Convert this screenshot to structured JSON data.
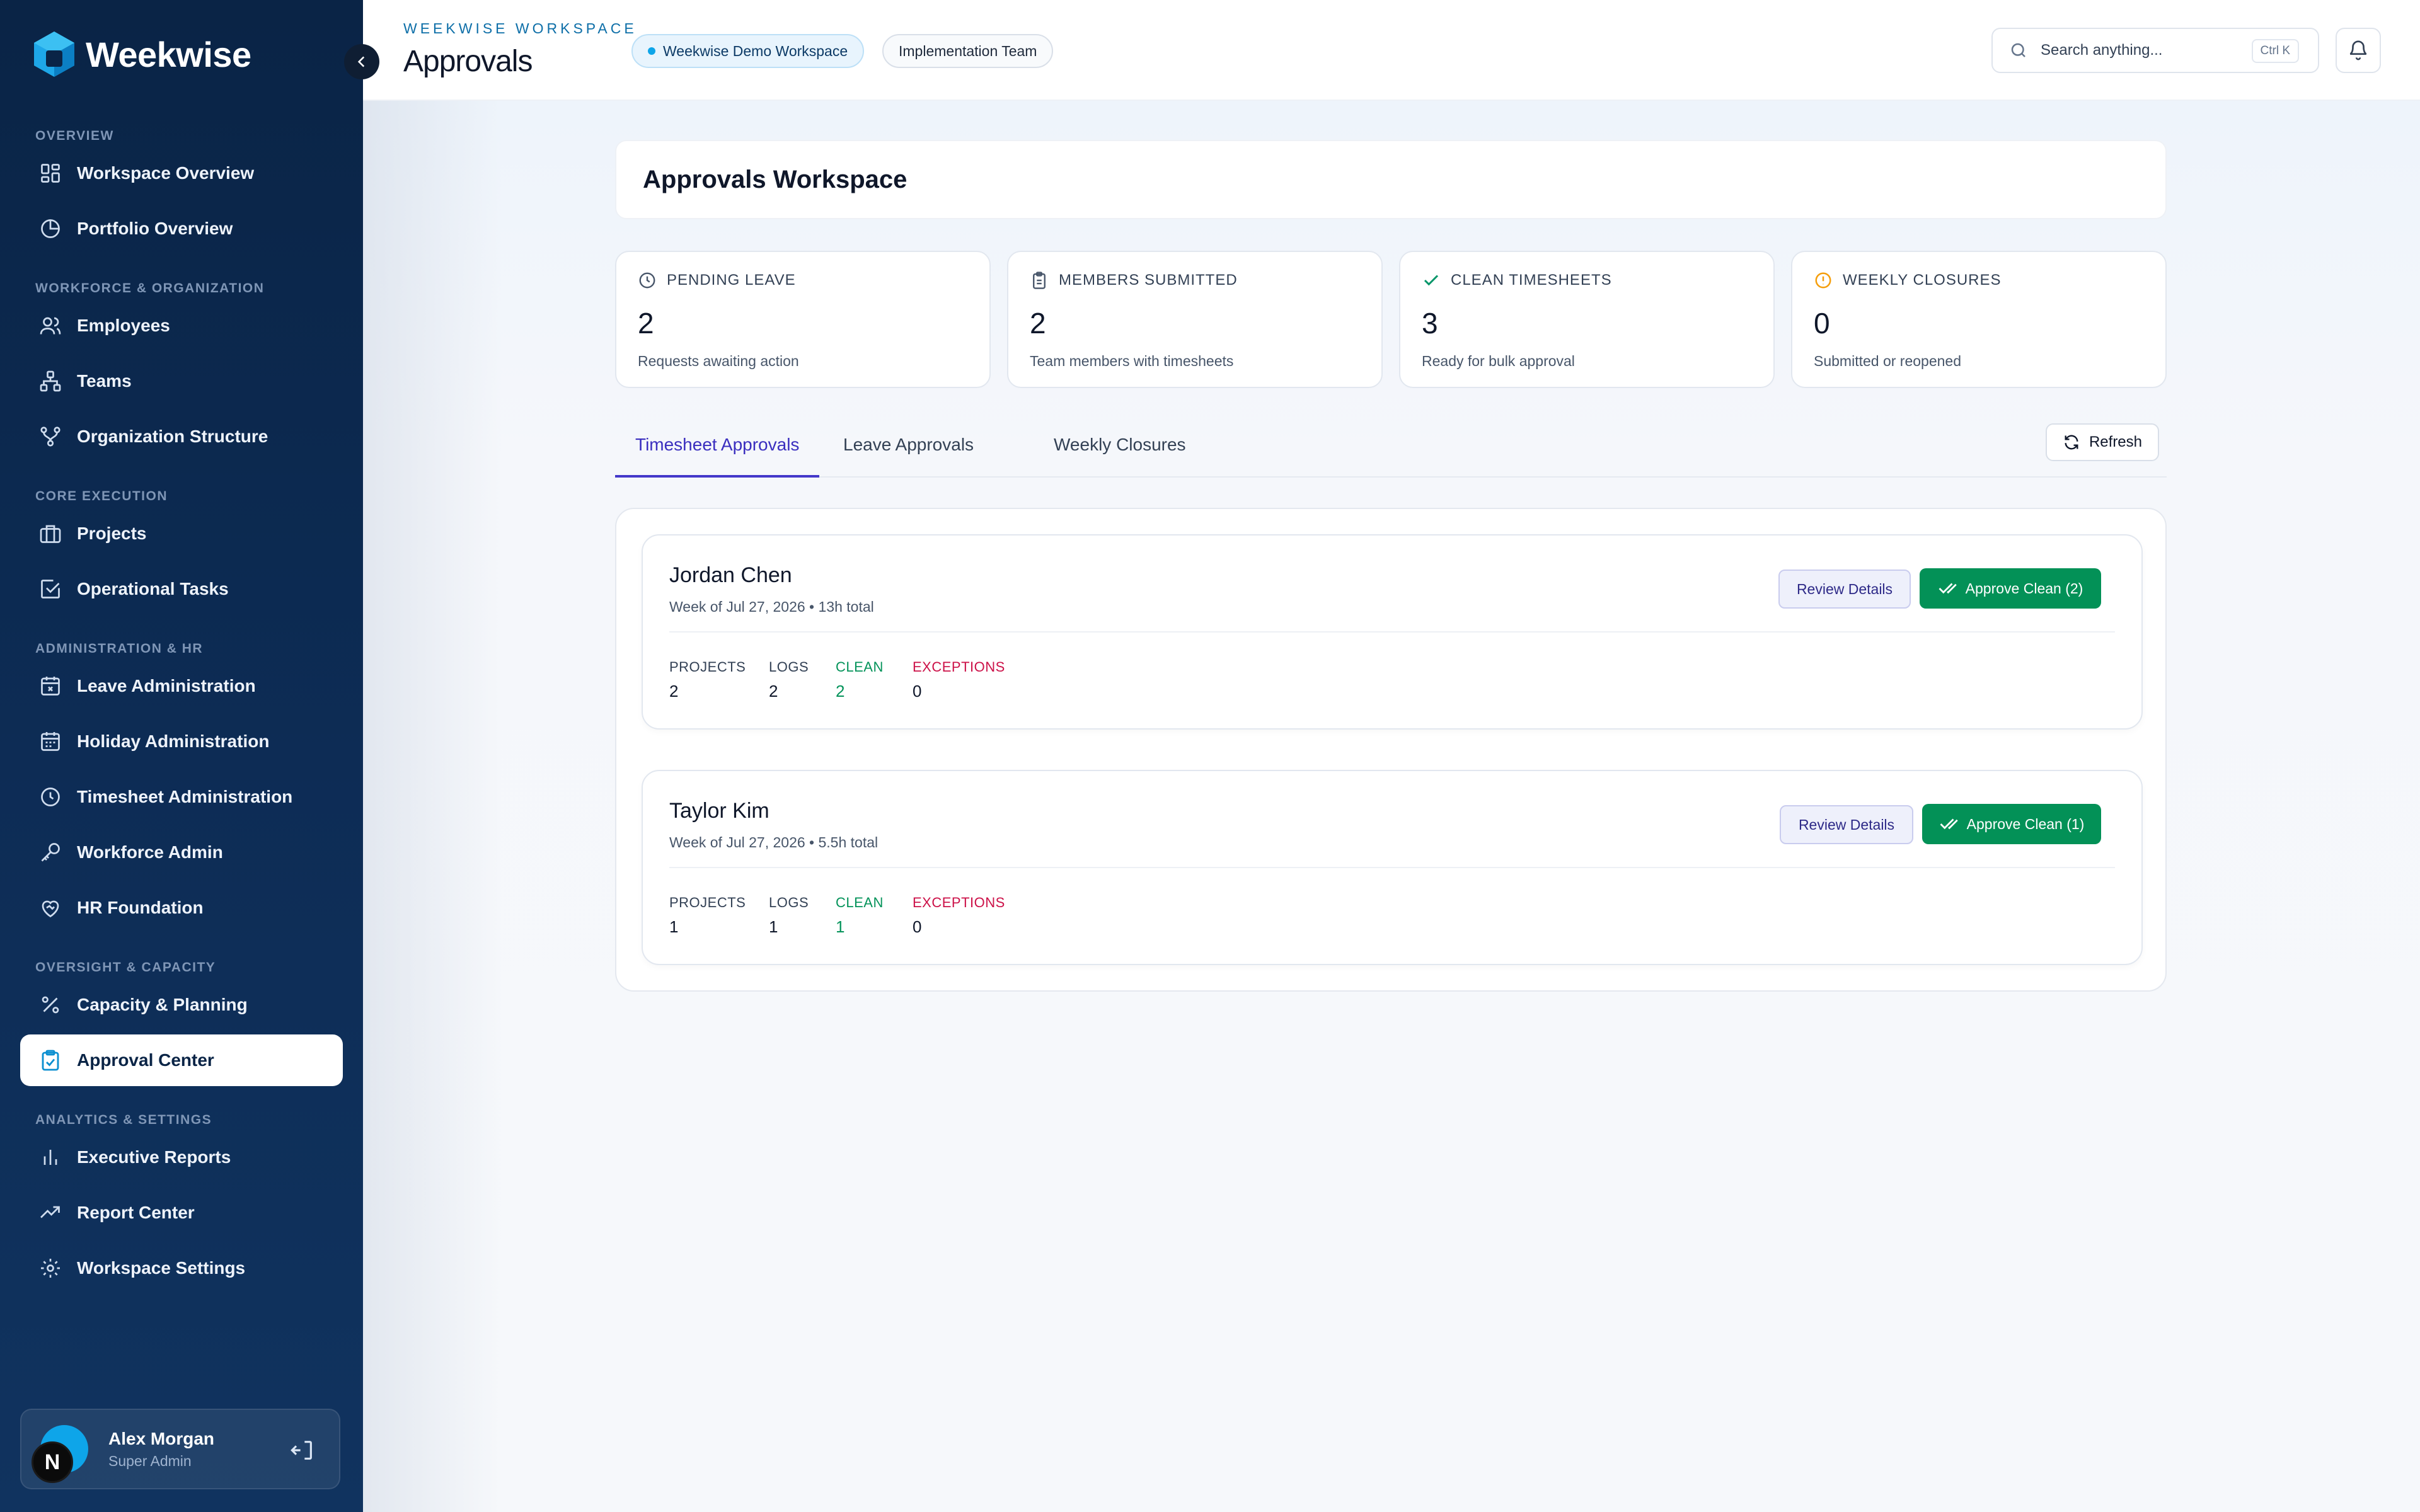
{
  "brand": {
    "name": "Weekwise"
  },
  "sidebar": {
    "sections": [
      {
        "label": "OVERVIEW",
        "items": [
          {
            "label": "Workspace Overview",
            "icon": "dashboard-icon"
          },
          {
            "label": "Portfolio Overview",
            "icon": "pie-chart-icon"
          }
        ]
      },
      {
        "label": "WORKFORCE & ORGANIZATION",
        "items": [
          {
            "label": "Employees",
            "icon": "users-icon"
          },
          {
            "label": "Teams",
            "icon": "network-icon"
          },
          {
            "label": "Organization Structure",
            "icon": "org-structure-icon"
          }
        ]
      },
      {
        "label": "CORE EXECUTION",
        "items": [
          {
            "label": "Projects",
            "icon": "briefcase-icon"
          },
          {
            "label": "Operational Tasks",
            "icon": "task-check-icon"
          }
        ]
      },
      {
        "label": "ADMINISTRATION & HR",
        "items": [
          {
            "label": "Leave Administration",
            "icon": "calendar-x-icon"
          },
          {
            "label": "Holiday Administration",
            "icon": "calendar-icon"
          },
          {
            "label": "Timesheet Administration",
            "icon": "clock-icon"
          },
          {
            "label": "Workforce Admin",
            "icon": "key-icon"
          },
          {
            "label": "HR Foundation",
            "icon": "heart-handshake-icon"
          }
        ]
      },
      {
        "label": "OVERSIGHT & CAPACITY",
        "items": [
          {
            "label": "Capacity & Planning",
            "icon": "percent-icon"
          },
          {
            "label": "Approval Center",
            "icon": "clipboard-check-icon",
            "active": true
          }
        ]
      },
      {
        "label": "ANALYTICS & SETTINGS",
        "items": [
          {
            "label": "Executive Reports",
            "icon": "bar-chart-icon"
          },
          {
            "label": "Report Center",
            "icon": "trending-up-icon"
          },
          {
            "label": "Workspace Settings",
            "icon": "gear-icon"
          }
        ]
      }
    ],
    "user": {
      "name": "Alex Morgan",
      "role": "Super Admin",
      "badge": "N"
    }
  },
  "header": {
    "eyebrow": "WEEKWISE WORKSPACE",
    "title": "Approvals",
    "workspace_pill": "Weekwise Demo Workspace",
    "team_pill": "Implementation Team",
    "search_placeholder": "Search anything...",
    "search_shortcut": "Ctrl K"
  },
  "main": {
    "panel_title": "Approvals Workspace",
    "stats": [
      {
        "label": "PENDING LEAVE",
        "value": "2",
        "sub": "Requests awaiting action",
        "icon": "clock-icon",
        "color": "#475569"
      },
      {
        "label": "MEMBERS SUBMITTED",
        "value": "2",
        "sub": "Team members with timesheets",
        "icon": "clipboard-icon",
        "color": "#475569"
      },
      {
        "label": "CLEAN TIMESHEETS",
        "value": "3",
        "sub": "Ready for bulk approval",
        "icon": "check-icon",
        "color": "#059669"
      },
      {
        "label": "WEEKLY CLOSURES",
        "value": "0",
        "sub": "Submitted or reopened",
        "icon": "alert-circle-icon",
        "color": "#f59e0b"
      }
    ],
    "tabs": [
      "Timesheet Approvals",
      "Leave Approvals",
      "Weekly Closures"
    ],
    "refresh_label": "Refresh",
    "entries": [
      {
        "name": "Jordan Chen",
        "week": "Week of Jul 27, 2026 • 13h total",
        "review_label": "Review Details",
        "approve_label": "Approve Clean (2)",
        "metrics": {
          "projects_label": "PROJECTS",
          "projects": "2",
          "logs_label": "LOGS",
          "logs": "2",
          "clean_label": "CLEAN",
          "clean": "2",
          "exceptions_label": "EXCEPTIONS",
          "exceptions": "0"
        }
      },
      {
        "name": "Taylor Kim",
        "week": "Week of Jul 27, 2026 • 5.5h total",
        "review_label": "Review Details",
        "approve_label": "Approve Clean (1)",
        "metrics": {
          "projects_label": "PROJECTS",
          "projects": "1",
          "logs_label": "LOGS",
          "logs": "1",
          "clean_label": "CLEAN",
          "clean": "1",
          "exceptions_label": "EXCEPTIONS",
          "exceptions": "0"
        }
      }
    ]
  }
}
